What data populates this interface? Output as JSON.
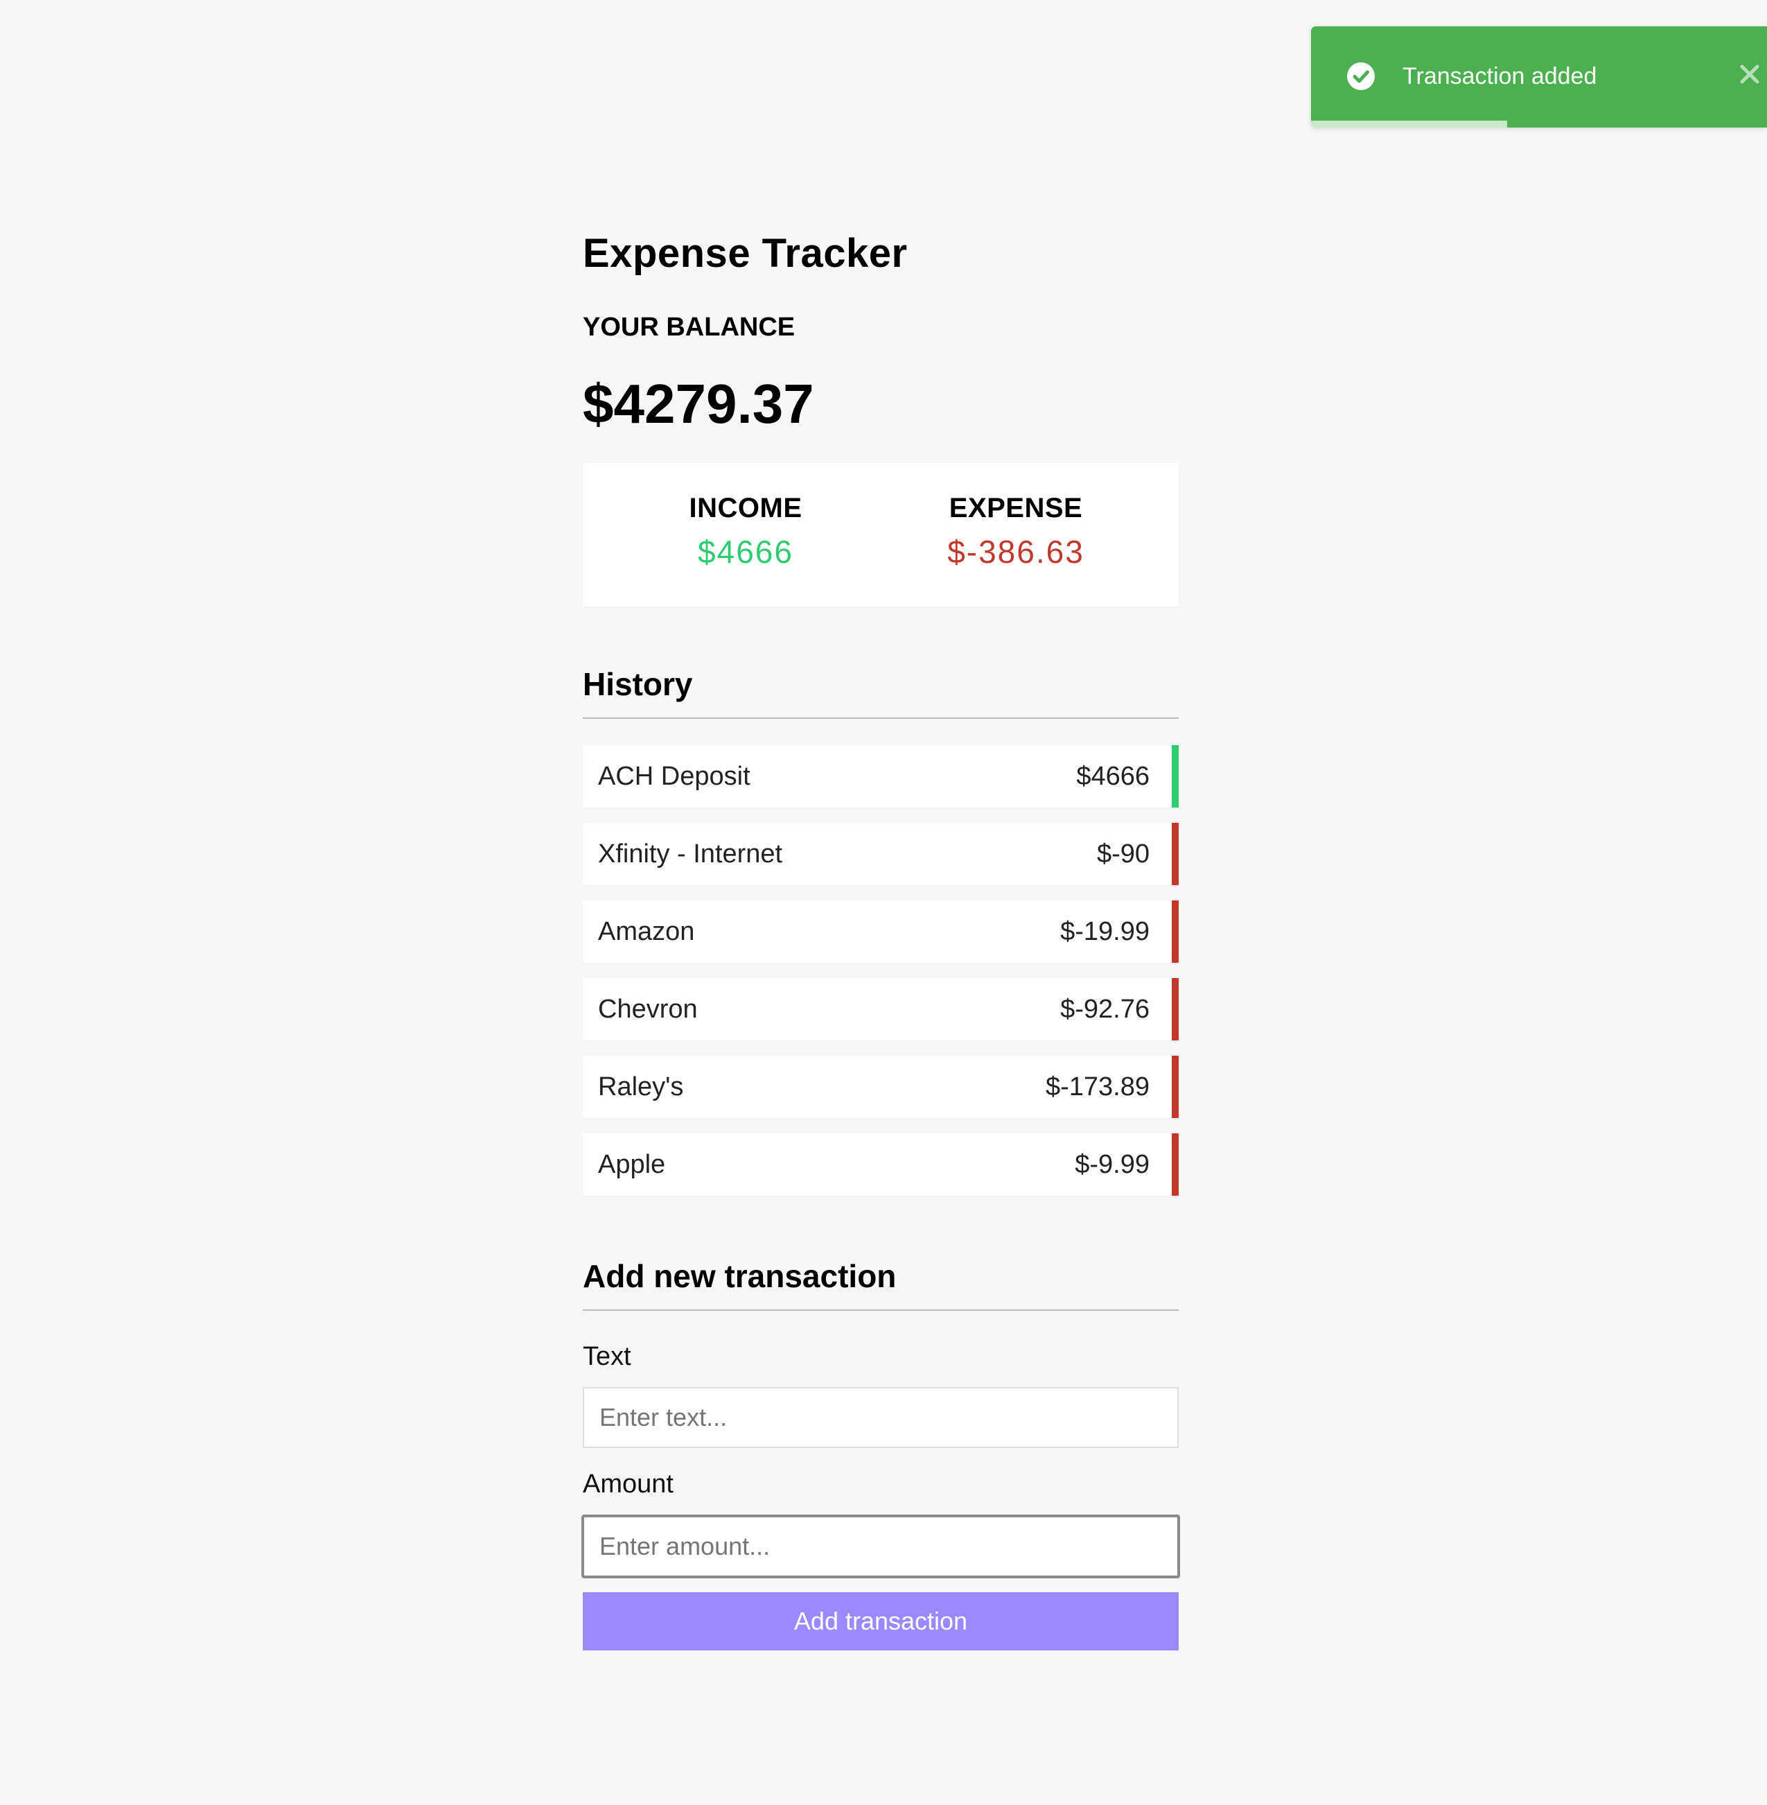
{
  "toast": {
    "message": "Transaction added",
    "progress_percent": 43,
    "icons": {
      "status": "check-circle-icon",
      "close": "close-icon"
    },
    "color": "#4caf50"
  },
  "app": {
    "title": "Expense Tracker",
    "balance_label": "YOUR BALANCE",
    "balance_value": "$4279.37"
  },
  "summary": {
    "income_label": "INCOME",
    "income_value": "$4666",
    "expense_label": "EXPENSE",
    "expense_value": "$-386.63",
    "colors": {
      "income": "#2ecc71",
      "expense": "#c0392b"
    }
  },
  "history": {
    "title": "History",
    "items": [
      {
        "text": "ACH Deposit",
        "amount": "$4666",
        "type": "plus"
      },
      {
        "text": "Xfinity - Internet",
        "amount": "$-90",
        "type": "minus"
      },
      {
        "text": "Amazon",
        "amount": "$-19.99",
        "type": "minus"
      },
      {
        "text": "Chevron",
        "amount": "$-92.76",
        "type": "minus"
      },
      {
        "text": "Raley's",
        "amount": "$-173.89",
        "type": "minus"
      },
      {
        "text": "Apple",
        "amount": "$-9.99",
        "type": "minus"
      }
    ]
  },
  "form": {
    "title": "Add new transaction",
    "text_label": "Text",
    "text_value": "",
    "text_placeholder": "Enter text...",
    "amount_label": "Amount",
    "amount_value": "",
    "amount_placeholder": "Enter amount...",
    "submit_label": "Add transaction",
    "button_color": "#9c88ff"
  }
}
